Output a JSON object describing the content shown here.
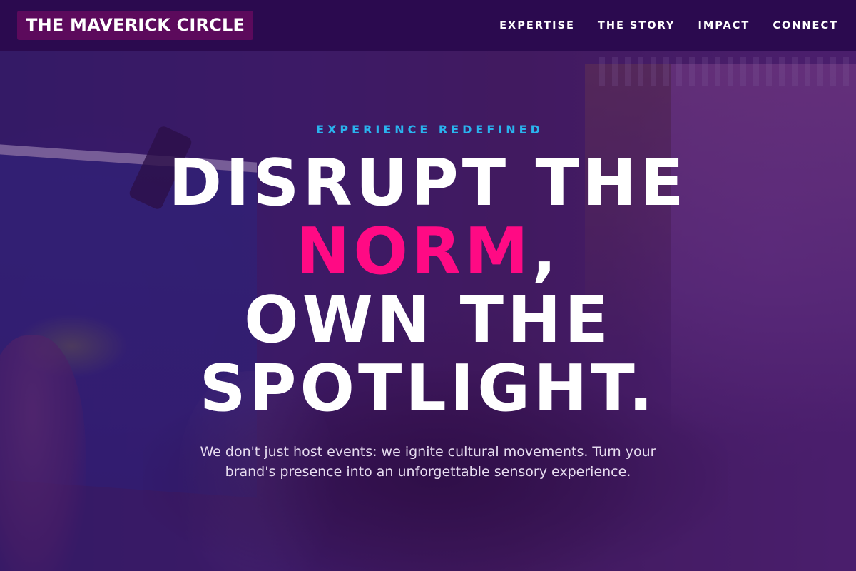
{
  "nav": {
    "logo": "THE MAVERICK CIRCLE",
    "links": [
      {
        "label": "EXPERTISE"
      },
      {
        "label": "THE STORY"
      },
      {
        "label": "IMPACT"
      },
      {
        "label": "CONNECT"
      }
    ]
  },
  "hero": {
    "eyebrow": "EXPERIENCE REDEFINED",
    "headline": {
      "line1": "DISRUPT THE",
      "accent": "NORM",
      "accent_suffix": ",",
      "line3": "OWN THE",
      "line4": "SPOTLIGHT."
    },
    "subtext": "We don't just host events: we ignite cultural movements. Turn your brand's presence into an unforgettable sensory experience."
  },
  "colors": {
    "nav_background": "#2b0a4f",
    "logo_background": "#5c0a5c",
    "eyebrow": "#2ab3ee",
    "accent": "#ff0a84",
    "headline": "#ffffff",
    "overlay": "#3a0c5c"
  },
  "background_image": {
    "description_icon": "event-photo-background"
  }
}
